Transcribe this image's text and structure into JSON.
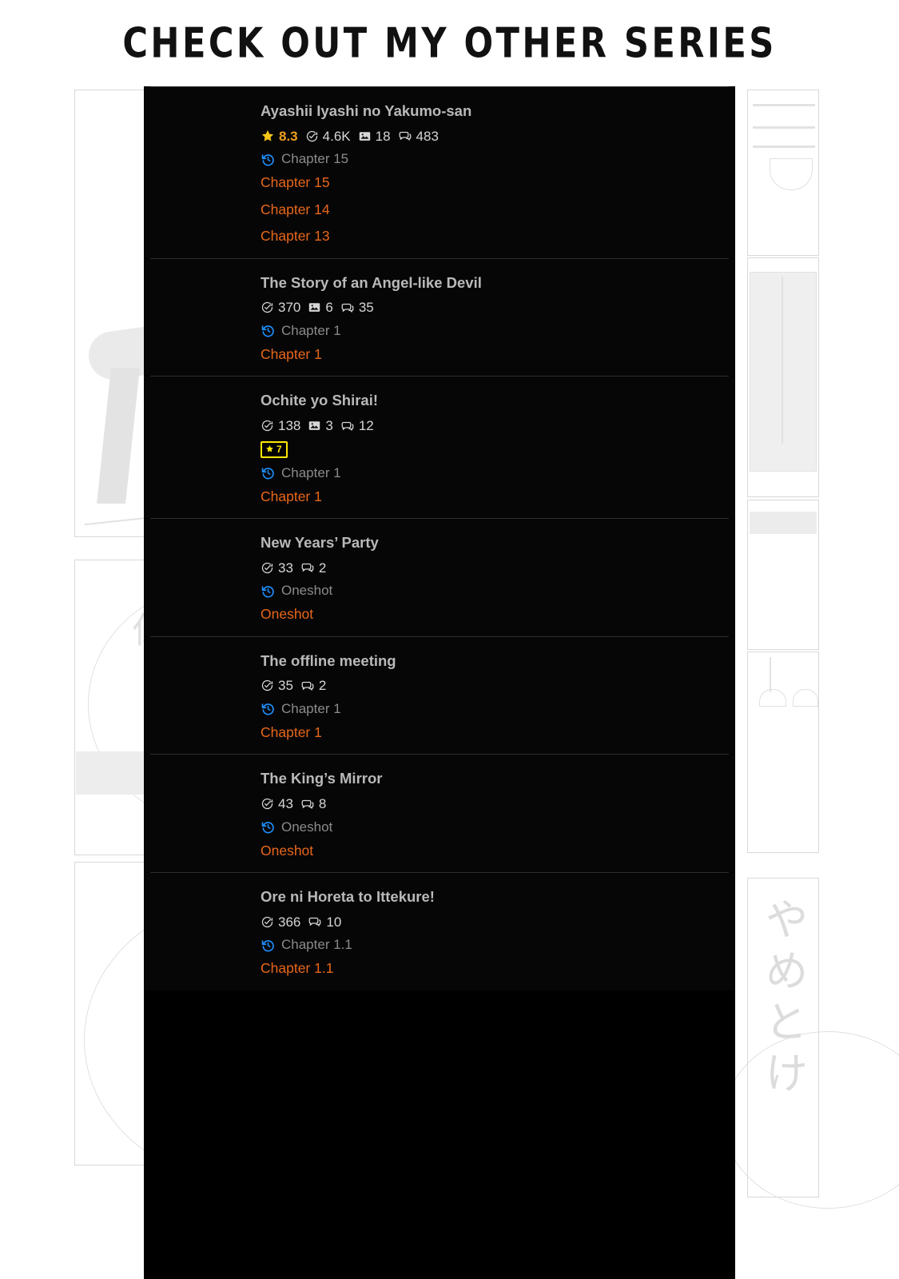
{
  "header": {
    "title": "CHECK OUT MY OTHER SERIES"
  },
  "colors": {
    "panel_background": "#000000",
    "card_background": "#060606",
    "title_text": "#b9b9b9",
    "stat_text": "#d6d6d6",
    "rating_accent": "#f0a020",
    "chapter_link": "#e8671a",
    "last_read_text": "#8b8b8b",
    "history_icon": "#1e90ff",
    "badge_yellow": "#ffe800",
    "divider": "#2e2e2e",
    "page_background": "#ffffff"
  },
  "icons": {
    "star": "star-icon",
    "views": "views-icon",
    "images": "image-count-icon",
    "comments": "comment-icon",
    "history": "history-icon"
  },
  "background": {
    "japanese_text": "やめとけ",
    "japanese_text_2": "仁"
  },
  "series": [
    {
      "id": "ayashii-iyashi-no-yakumo-san",
      "title": "Ayashii Iyashi no Yakumo-san",
      "rating": "8.3",
      "views": "4.6K",
      "images": "18",
      "comments": "483",
      "badge": null,
      "last_read_label": "Chapter 15",
      "chapters": [
        "Chapter 15",
        "Chapter 14",
        "Chapter 13"
      ],
      "cover_style": "color-illustration"
    },
    {
      "id": "the-story-of-an-angel-like-devil",
      "title": "The Story of an Angel-like Devil",
      "rating": null,
      "views": "370",
      "images": "6",
      "comments": "35",
      "badge": null,
      "last_read_label": "Chapter 1",
      "chapters": [
        "Chapter 1"
      ],
      "cover_style": "mono-manga-a"
    },
    {
      "id": "ochite-yo-shirai",
      "title": "Ochite yo Shirai!",
      "rating": null,
      "views": "138",
      "images": "3",
      "comments": "12",
      "badge": "7",
      "last_read_label": "Chapter 1",
      "chapters": [
        "Chapter 1"
      ],
      "cover_style": "mono-manga-b"
    },
    {
      "id": "new-years-party",
      "title": "New Years’ Party",
      "rating": null,
      "views": "33",
      "images": null,
      "comments": "2",
      "badge": null,
      "last_read_label": "Oneshot",
      "chapters": [
        "Oneshot"
      ],
      "cover_style": "mono-manga-c"
    },
    {
      "id": "the-offline-meeting",
      "title": "The offline meeting",
      "rating": null,
      "views": "35",
      "images": null,
      "comments": "2",
      "badge": null,
      "last_read_label": "Chapter 1",
      "chapters": [
        "Chapter 1"
      ],
      "cover_style": "mono-manga-d"
    },
    {
      "id": "the-kings-mirror",
      "title": "The King’s Mirror",
      "rating": null,
      "views": "43",
      "images": null,
      "comments": "8",
      "badge": null,
      "last_read_label": "Oneshot",
      "chapters": [
        "Oneshot"
      ],
      "cover_style": "mono-manga-e"
    },
    {
      "id": "ore-ni-horeta-to-ittekure",
      "title": "Ore ni Horeta to Ittekure!",
      "rating": null,
      "views": "366",
      "images": null,
      "comments": "10",
      "badge": null,
      "last_read_label": "Chapter 1.1",
      "chapters": [
        "Chapter 1.1"
      ],
      "cover_style": "color-cover-blue"
    }
  ]
}
